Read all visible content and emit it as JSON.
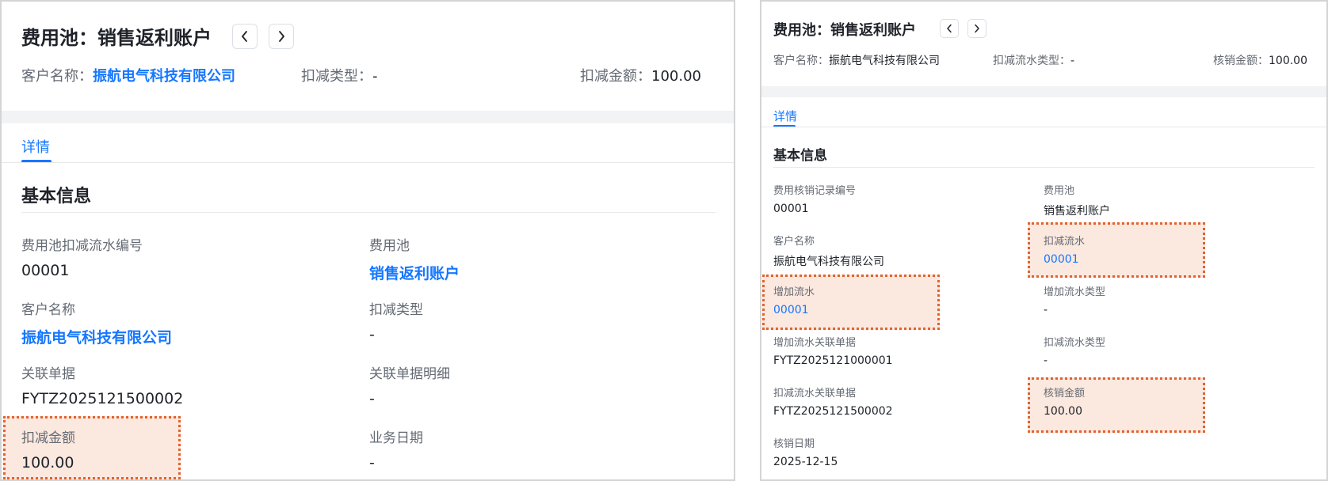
{
  "left": {
    "title": "费用池：销售返利账户",
    "meta": {
      "customer_label": "客户名称：",
      "customer_value": "振航电气科技有限公司",
      "type_label": "扣减类型：",
      "type_value": "-",
      "amount_label": "扣减金额：",
      "amount_value": "100.00"
    },
    "tab": "详情",
    "section_title": "基本信息",
    "fields": [
      {
        "label": "费用池扣减流水编号",
        "value": "00001"
      },
      {
        "label": "费用池",
        "value": "销售返利账户"
      },
      {
        "label": "客户名称",
        "value": "振航电气科技有限公司"
      },
      {
        "label": "扣减类型",
        "value": "-"
      },
      {
        "label": "关联单据",
        "value": "FYTZ2025121500002"
      },
      {
        "label": "关联单据明细",
        "value": "-"
      },
      {
        "label": "扣减金额",
        "value": "100.00"
      },
      {
        "label": "业务日期",
        "value": "-"
      }
    ]
  },
  "right": {
    "title": "费用池：销售返利账户",
    "meta": {
      "customer_label": "客户名称：",
      "customer_value": "振航电气科技有限公司",
      "type_label": "扣减流水类型：",
      "type_value": "-",
      "amount_label": "核销金额：",
      "amount_value": "100.00"
    },
    "tab": "详情",
    "section_title": "基本信息",
    "fields": [
      {
        "label": "费用核销记录编号",
        "value": "00001"
      },
      {
        "label": "费用池",
        "value": "销售返利账户"
      },
      {
        "label": "客户名称",
        "value": "振航电气科技有限公司"
      },
      {
        "label": "扣减流水",
        "value": "00001"
      },
      {
        "label": "增加流水",
        "value": "00001"
      },
      {
        "label": "增加流水类型",
        "value": "-"
      },
      {
        "label": "增加流水关联单据",
        "value": "FYTZ2025121000001"
      },
      {
        "label": "扣减流水类型",
        "value": "-"
      },
      {
        "label": "扣减流水关联单据",
        "value": "FYTZ2025121500002"
      },
      {
        "label": "核销金额",
        "value": "100.00"
      },
      {
        "label": "核销日期",
        "value": "2025-12-15"
      }
    ]
  },
  "colors": {
    "accent": "#1677ff",
    "highlight_fill": "#fbe8df",
    "highlight_border": "#e2622e"
  },
  "icons": [
    "chevron-left-icon",
    "chevron-right-icon"
  ]
}
